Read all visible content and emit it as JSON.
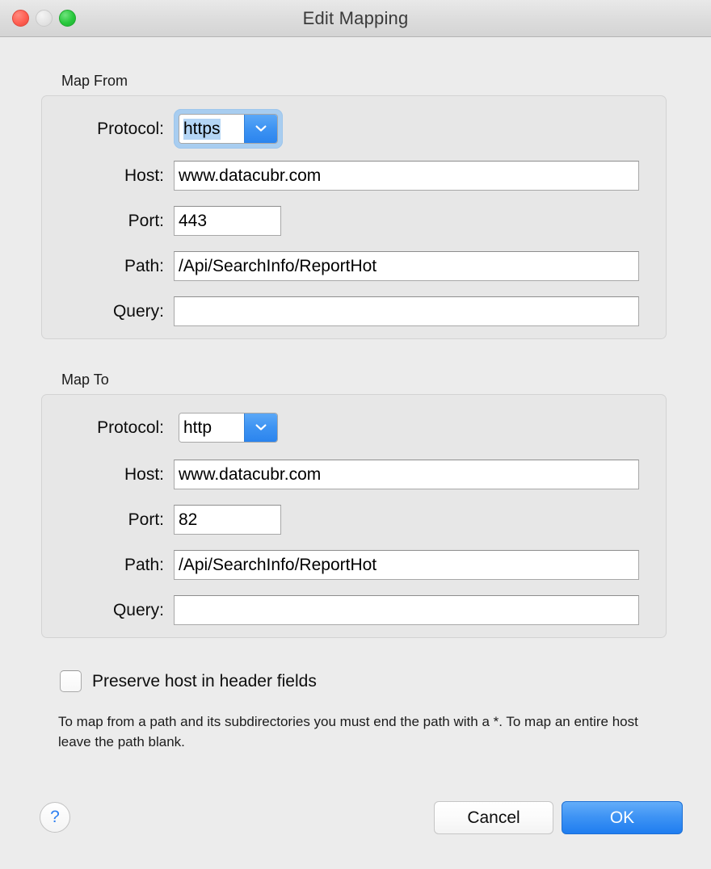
{
  "window": {
    "title": "Edit Mapping",
    "traffic_lights": [
      {
        "name": "close",
        "color": "#ff5f52"
      },
      {
        "name": "minimize",
        "color": "#e3e3e3"
      },
      {
        "name": "zoom",
        "color": "#28c83c"
      }
    ]
  },
  "map_from": {
    "group_title": "Map From",
    "protocol": {
      "label": "Protocol:",
      "value": "https",
      "selected": true,
      "options": [
        "http",
        "https"
      ]
    },
    "host": {
      "label": "Host:",
      "value": "www.datacubr.com",
      "placeholder": ""
    },
    "port": {
      "label": "Port:",
      "value": "443",
      "placeholder": ""
    },
    "path": {
      "label": "Path:",
      "value": "/Api/SearchInfo/ReportHot",
      "placeholder": ""
    },
    "query": {
      "label": "Query:",
      "value": "",
      "placeholder": ""
    }
  },
  "map_to": {
    "group_title": "Map To",
    "protocol": {
      "label": "Protocol:",
      "value": "http",
      "selected": false,
      "options": [
        "http",
        "https"
      ]
    },
    "host": {
      "label": "Host:",
      "value": "www.datacubr.com",
      "placeholder": ""
    },
    "port": {
      "label": "Port:",
      "value": "82",
      "placeholder": ""
    },
    "path": {
      "label": "Path:",
      "value": "/Api/SearchInfo/ReportHot",
      "placeholder": ""
    },
    "query": {
      "label": "Query:",
      "value": "",
      "placeholder": ""
    }
  },
  "options": {
    "preserve_host": {
      "label": "Preserve host in header fields",
      "checked": false
    }
  },
  "help_text": "To map from a path and its subdirectories you must end the path with a *. To map an entire host leave the path blank.",
  "footer": {
    "help_button": "?",
    "cancel_label": "Cancel",
    "ok_label": "OK"
  },
  "colors": {
    "accent": "#3d93f4",
    "window_bg": "#ececec",
    "group_bg": "#e7e7e7",
    "selection": "#b4d5f5",
    "focus_ring": "#a8cdf0"
  }
}
